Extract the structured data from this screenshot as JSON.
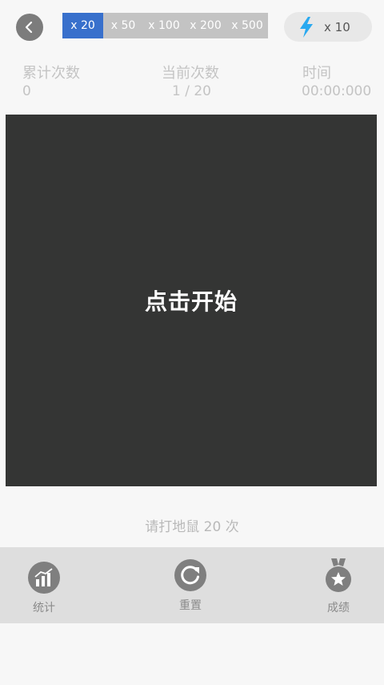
{
  "header": {
    "multipliers": [
      "x 20",
      "x 50",
      "x 100",
      "x 200",
      "x 500"
    ],
    "active_multiplier": "x 20",
    "boost_label": "x 10"
  },
  "stats": {
    "total_label": "累计次数",
    "total_value": "0",
    "current_label": "当前次数",
    "current_value": "1 / 20",
    "time_label": "时间",
    "time_value": "00:00:000"
  },
  "board": {
    "start_label": "点击开始"
  },
  "hint": "请打地鼠 20 次",
  "bottom_nav": {
    "stats_label": "统计",
    "reset_label": "重置",
    "score_label": "成绩"
  },
  "colors": {
    "accent": "#3870cc",
    "segment_bg": "#c3c3c3",
    "board_bg": "#343534",
    "bolt": "#29a9f0",
    "icon_gray": "#7f7f7f"
  }
}
